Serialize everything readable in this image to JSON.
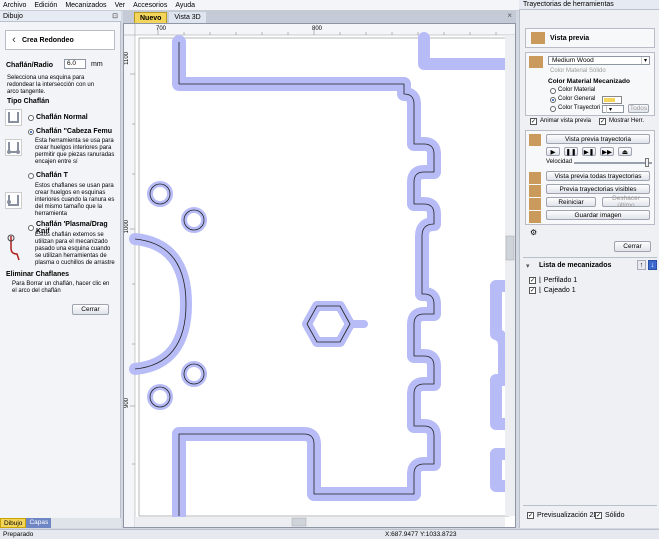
{
  "menu": [
    "Archivo",
    "Edición",
    "Mecanizados",
    "Ver",
    "Accesorios",
    "Ayuda"
  ],
  "left_panel": {
    "title": "Dibujo",
    "tool_title": "Crea Redondeo",
    "radius_label": "Chaflán/Radio",
    "radius_value": "6.0",
    "radius_unit": "mm",
    "instructions": "Selecciona una esquina para redondear la intersección con un arco tangente.",
    "type_heading": "Tipo Chaflán",
    "options": [
      {
        "label": "Chaflán Normal",
        "selected": false,
        "desc": ""
      },
      {
        "label": "Chaflán \"Cabeza Femu",
        "selected": true,
        "desc": "Esta herramienta se usa para crear huelgos interiores para permitir que piezas ranuradas encajen entre sí"
      },
      {
        "label": "Chaflán T",
        "selected": false,
        "desc": "Estos chaflanes se usan para crear huelgos en esquinas interiores cuando la ranura es del mismo tamaño que la herramienta"
      },
      {
        "label": "Chaflán 'Plasma/Drag Knif",
        "selected": false,
        "desc": "Estos chaflán externos se utilizan para el mecanizado pasado una esquina cuando se utilizan herramientas de plasma o cuchillos de arrastre"
      }
    ],
    "remove_heading": "Eliminar Chaflanes",
    "remove_desc": "Para Borrar un chaflán, hacer clic en el arco del chaflán",
    "close_label": "Cerrar",
    "tabs": [
      "Dibujo",
      "Capas"
    ]
  },
  "center": {
    "tabs": [
      "Nuevo",
      "Vista 3D"
    ],
    "ruler_top": [
      "700",
      "800"
    ],
    "ruler_left": [
      "1100",
      "1000",
      "900"
    ]
  },
  "right_panel": {
    "title": "Trayectorias de herramientas",
    "preview_heading": "Vista previa",
    "material": "Medium Wood",
    "solid_color_label": "Color Material Sólido",
    "color_heading": "Color Material Mecanizado",
    "color_options": [
      {
        "label": "Color Material",
        "selected": false
      },
      {
        "label": "Color General",
        "selected": true
      },
      {
        "label": "Color Trayectori",
        "selected": false
      }
    ],
    "all_label": "Todos",
    "animate_label": "Animar vista previa",
    "show_tool_label": "Mostrar Herr.",
    "preview_toolpath_label": "Vista previa trayectoria",
    "speed_label": "Velocidad",
    "preview_all_label": "Vista previa todas trayectorias",
    "preview_visible_label": "Previa trayectorias visibles",
    "reset_label": "Reiniciar",
    "undo_label": "Deshacer último",
    "save_image_label": "Guardar imagen",
    "close_label": "Cerrar",
    "list_heading": "Lista de mecanizados",
    "toolpaths": [
      "Perfilado 1",
      "Cajeado 1"
    ],
    "preview2d_label": "Previsualización 2D",
    "solid_label": "Sólido",
    "accent_color": "#f3d55b"
  },
  "status": {
    "left": "Preparado",
    "coords": "X:687.9477 Y:1033.8723"
  }
}
